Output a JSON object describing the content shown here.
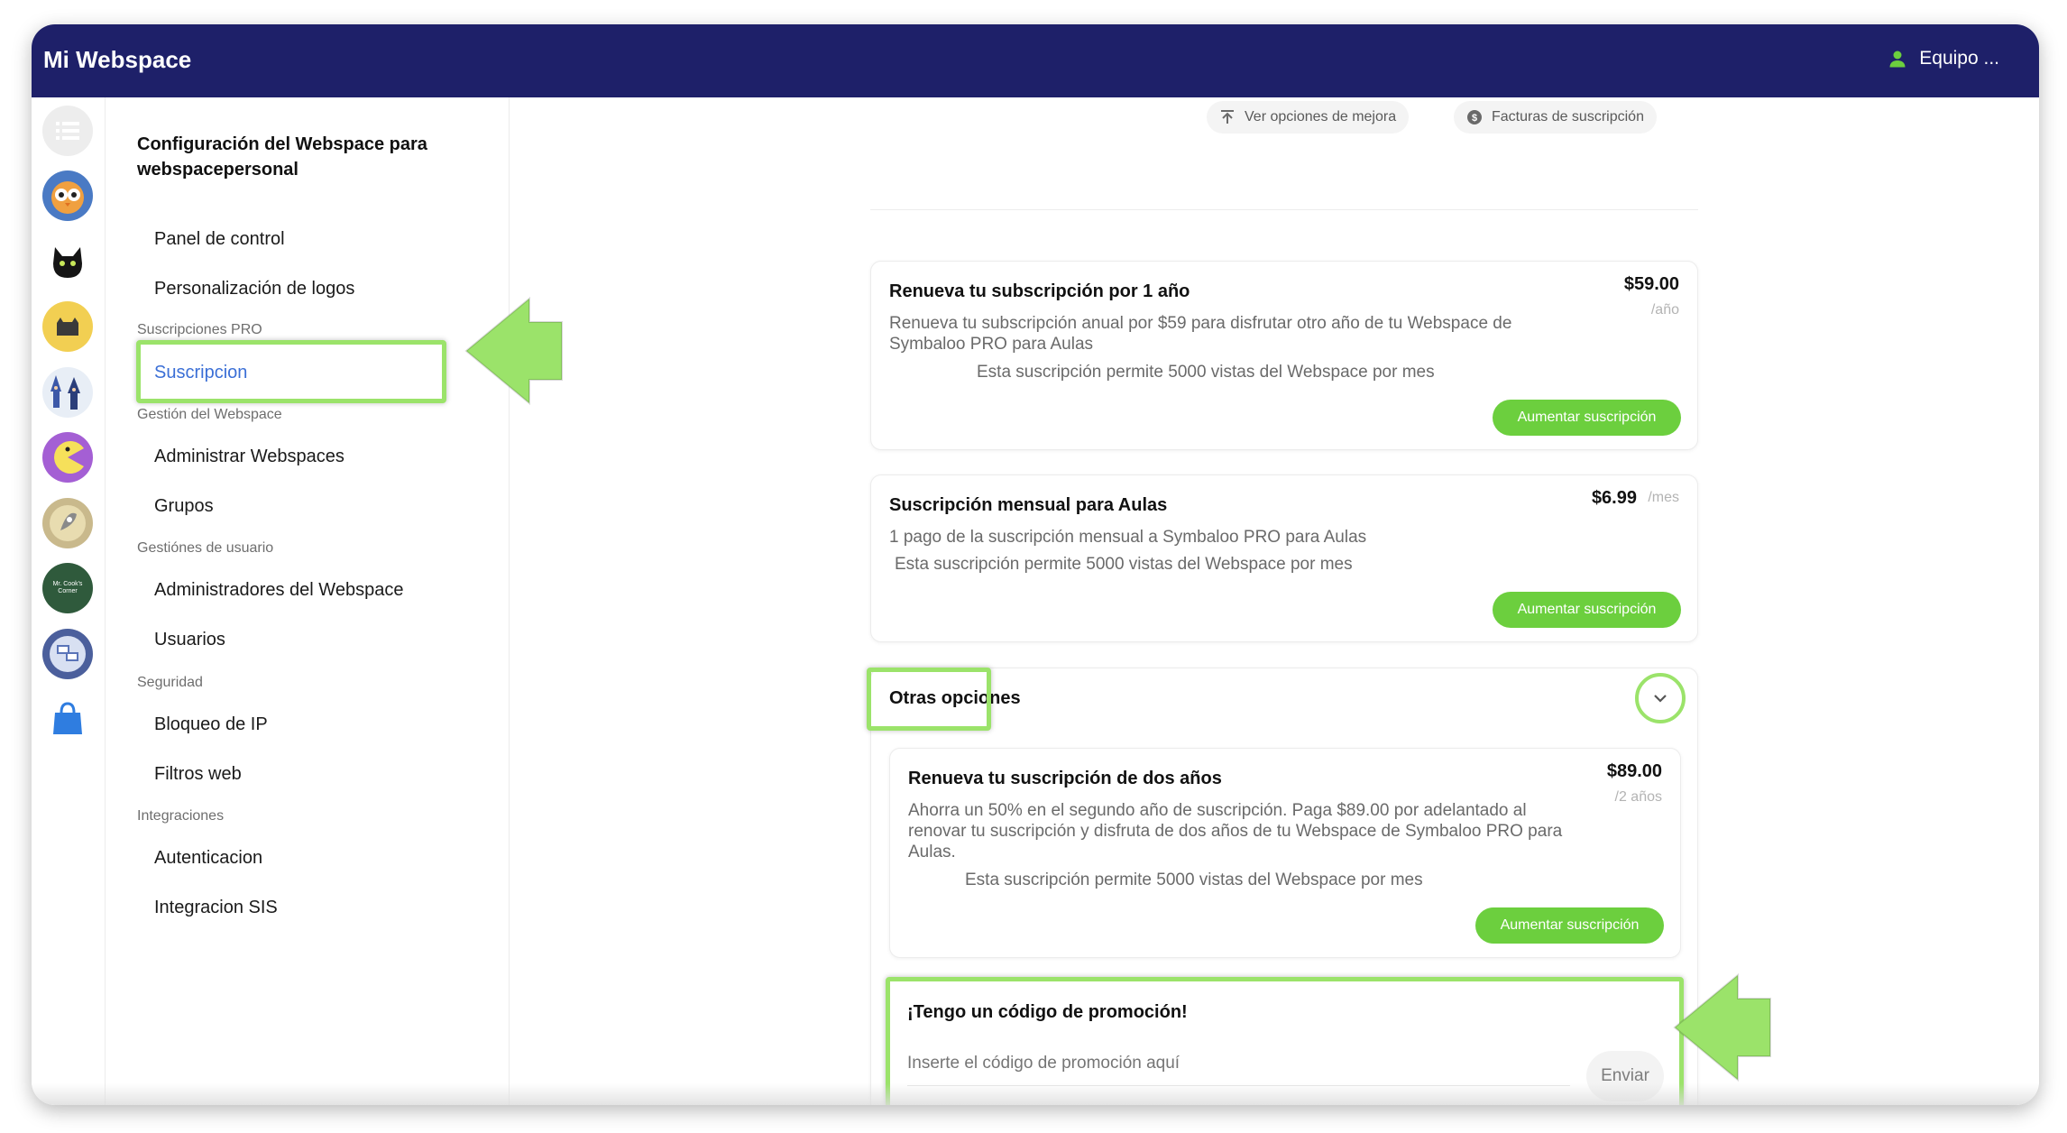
{
  "app": {
    "title": "Mi Webspace",
    "team_label": "Equipo ..."
  },
  "rail": {
    "items": [
      "list-icon",
      "owl-avatar",
      "black-cat-avatar",
      "yellow-cat-avatar",
      "wizards-avatar",
      "pacman-avatar",
      "rocket-avatar",
      "mr-cooks-corner-avatar",
      "computer-avatar",
      "shopping-bag-icon"
    ],
    "mr_cooks_text": "Mr. Cook's Corner"
  },
  "sidebar": {
    "heading": "Configuración del Webspace para webspacepersonal",
    "panel": "Panel de control",
    "logos": "Personalización de logos",
    "section_pro": "Suscripciones PRO",
    "suscripcion": "Suscripcion",
    "section_gestion": "Gestión del Webspace",
    "administrar": "Administrar Webspaces",
    "grupos": "Grupos",
    "section_usuario": "Gestiónes de usuario",
    "administradores": "Administradores del Webspace",
    "usuarios": "Usuarios",
    "section_seguridad": "Seguridad",
    "bloqueo": "Bloqueo de IP",
    "filtros": "Filtros web",
    "section_integraciones": "Integraciones",
    "autenticacion": "Autenticacion",
    "sis": "Integracion SIS"
  },
  "top_actions": {
    "mejora": "Ver opciones de mejora",
    "facturas": "Facturas de suscripción"
  },
  "plan_annual": {
    "title": "Renueva tu subscripción por 1 año",
    "desc": "Renueva tu subscripción anual por $59 para disfrutar otro año de tu Webspace de Symbaloo PRO para Aulas",
    "note": "Esta suscripción permite 5000 vistas del Webspace por mes",
    "price": "$59.00",
    "period": "/año",
    "button": "Aumentar suscripción"
  },
  "plan_monthly": {
    "title": "Suscripción mensual para Aulas",
    "desc": "1 pago de la suscripción mensual a Symbaloo PRO para Aulas",
    "note": "Esta suscripción permite 5000 vistas del Webspace por mes",
    "price": "$6.99",
    "period": "/mes",
    "button": "Aumentar suscripción"
  },
  "other_options": {
    "title": "Otras opciones"
  },
  "plan_two_years": {
    "title": "Renueva tu suscripción de dos años",
    "desc": "Ahorra un 50% en el segundo año de suscripción. Paga $89.00 por adelantado al renovar tu suscripción y disfruta de dos años de tu Webspace de Symbaloo PRO para Aulas.",
    "note": "Esta suscripción permite 5000 vistas del Webspace por mes",
    "price": "$89.00",
    "period": "/2 años",
    "button": "Aumentar suscripción"
  },
  "promo": {
    "title": "¡Tengo un código de promoción!",
    "placeholder": "Inserte el código de promoción aquí",
    "send": "Enviar"
  },
  "colors": {
    "topbar": "#1e2069",
    "accent_green": "#6ccf3e",
    "highlight": "#9be36a",
    "active_link": "#3b6fd6"
  }
}
